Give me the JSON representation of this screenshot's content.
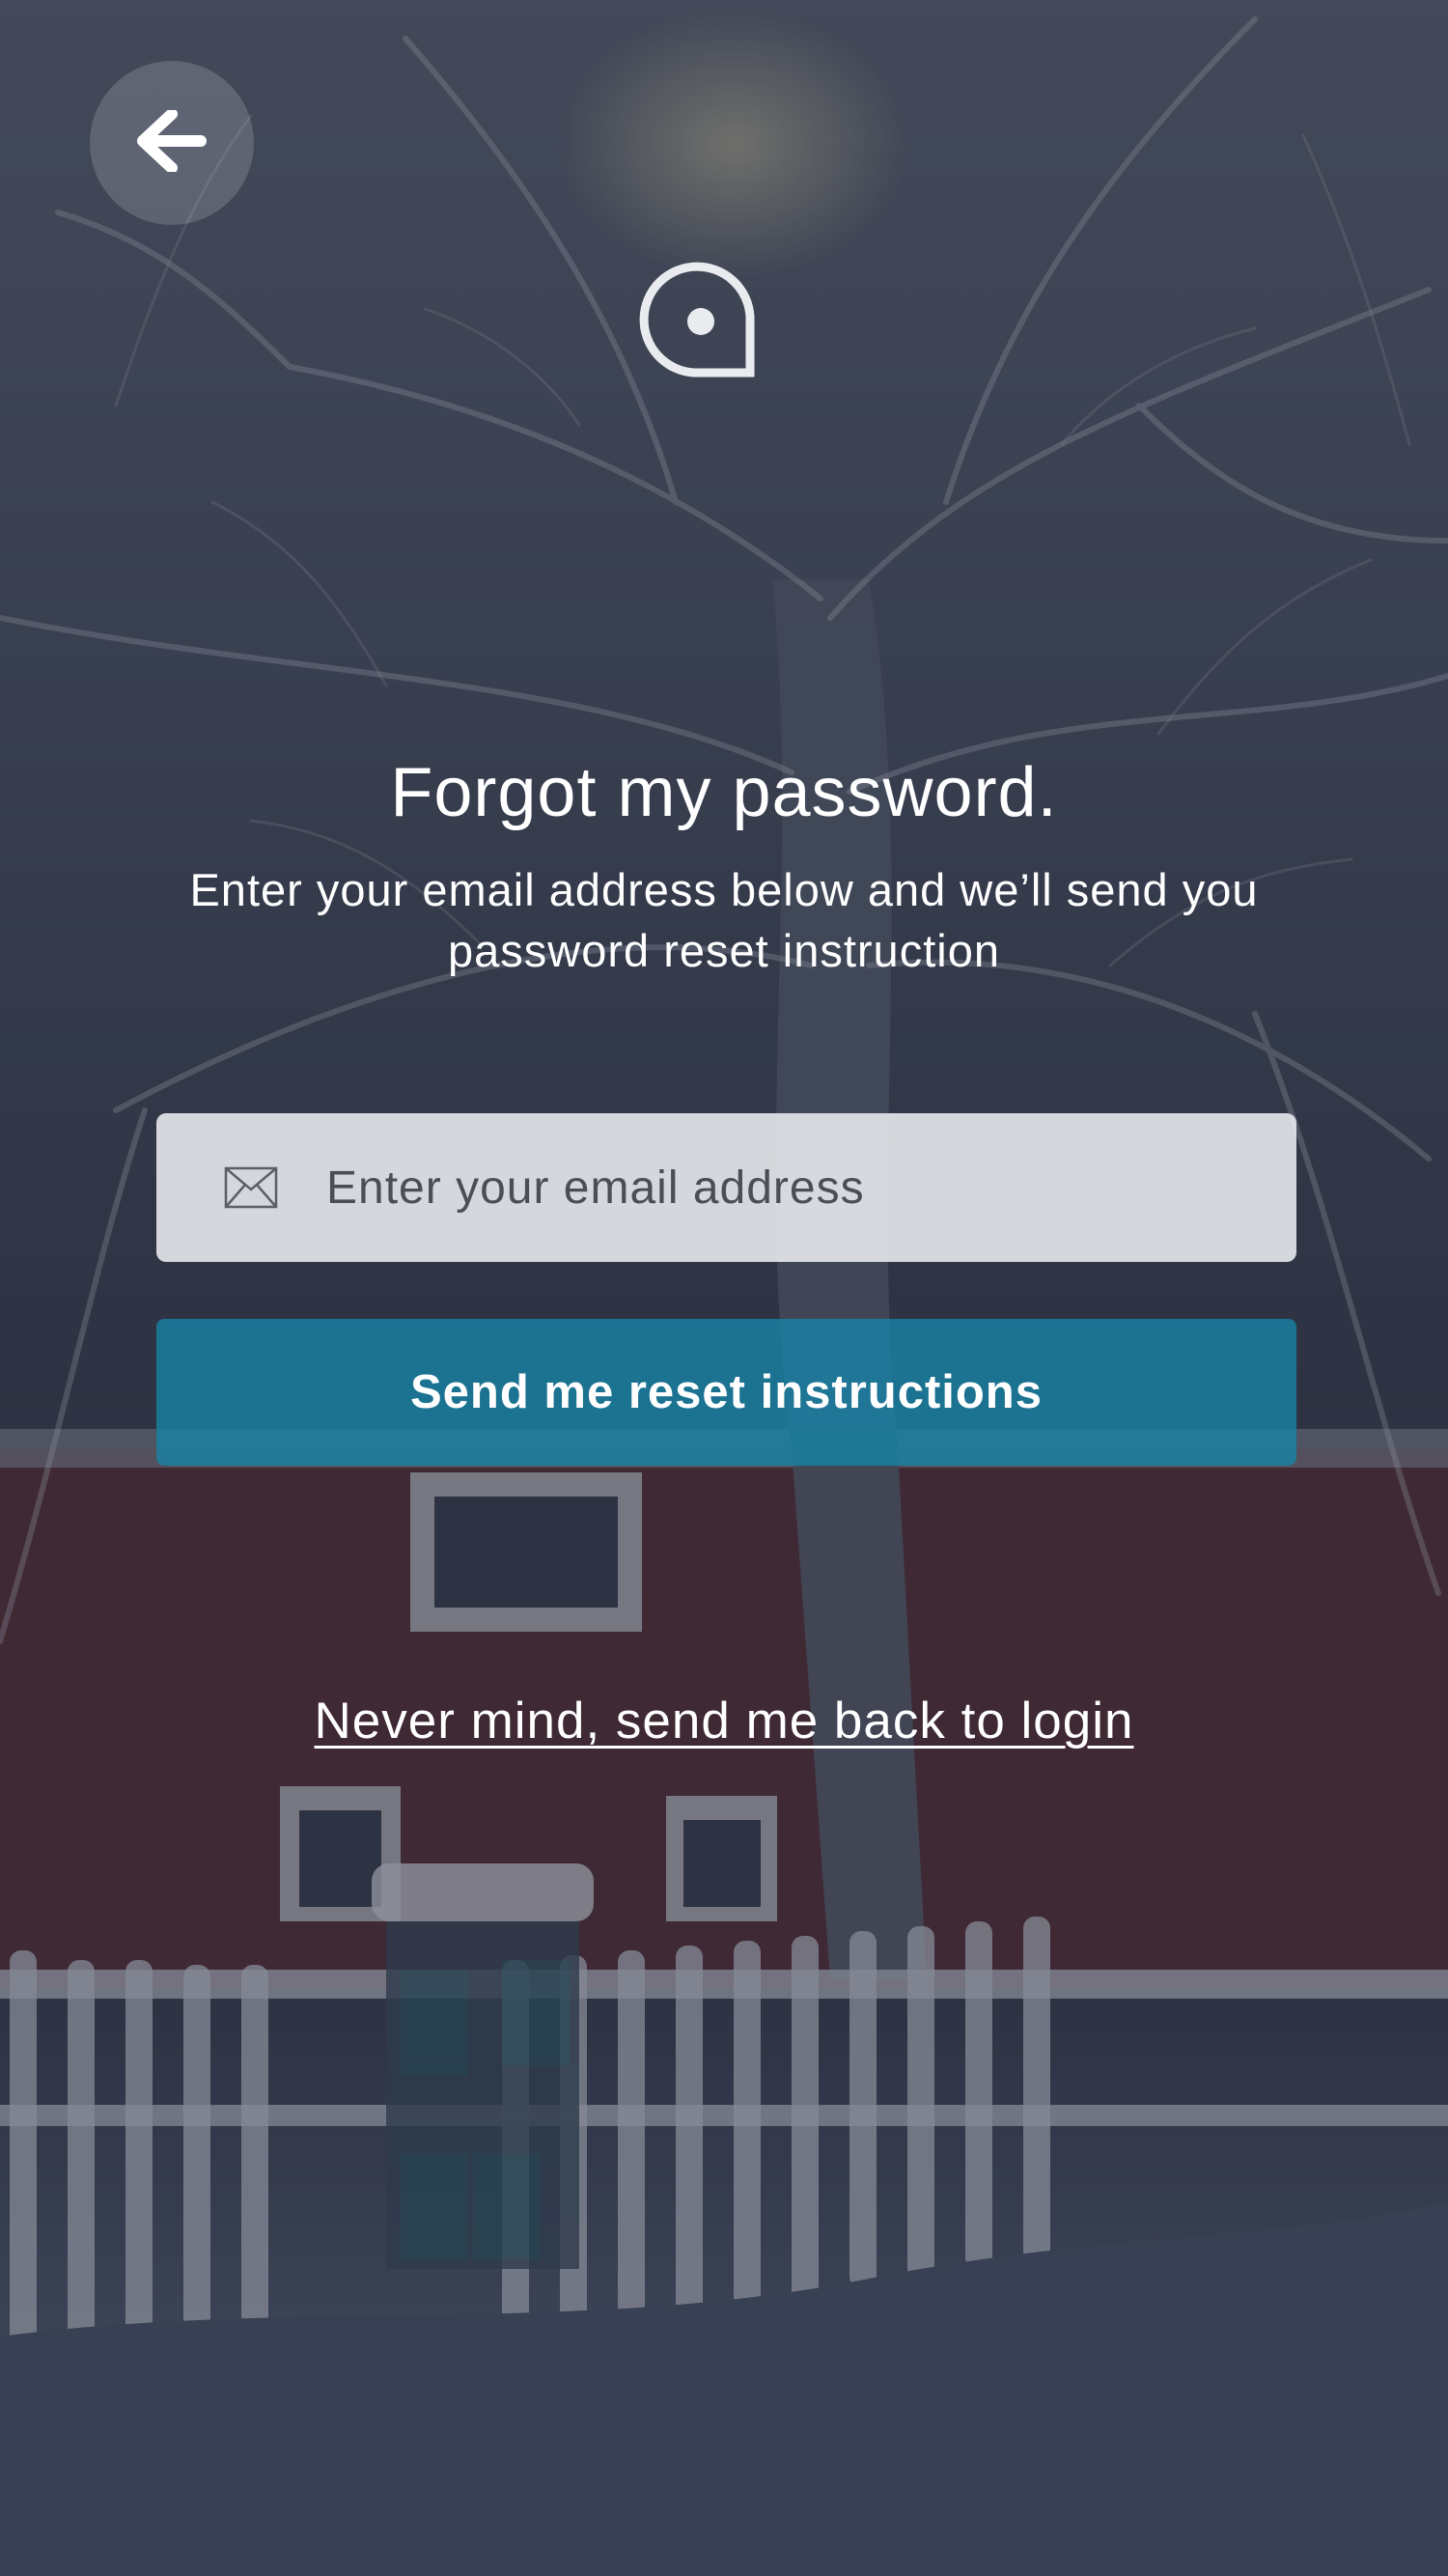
{
  "screen": {
    "title": "Forgot my password.",
    "subtitle": "Enter your email address below and we’ll send you password reset instruction"
  },
  "nav": {
    "back_icon": "arrow-left-icon"
  },
  "brand": {
    "logo_icon": "speech-bubble-logo-icon"
  },
  "email": {
    "placeholder": "Enter your email address",
    "value": "",
    "icon": "envelope-icon"
  },
  "actions": {
    "reset_label": "Send me reset instructions",
    "back_to_login_label": "Never mind, send me back to login"
  },
  "colors": {
    "accent": "#1684a8",
    "input_background": "#eceef1",
    "text": "#ffffff"
  }
}
